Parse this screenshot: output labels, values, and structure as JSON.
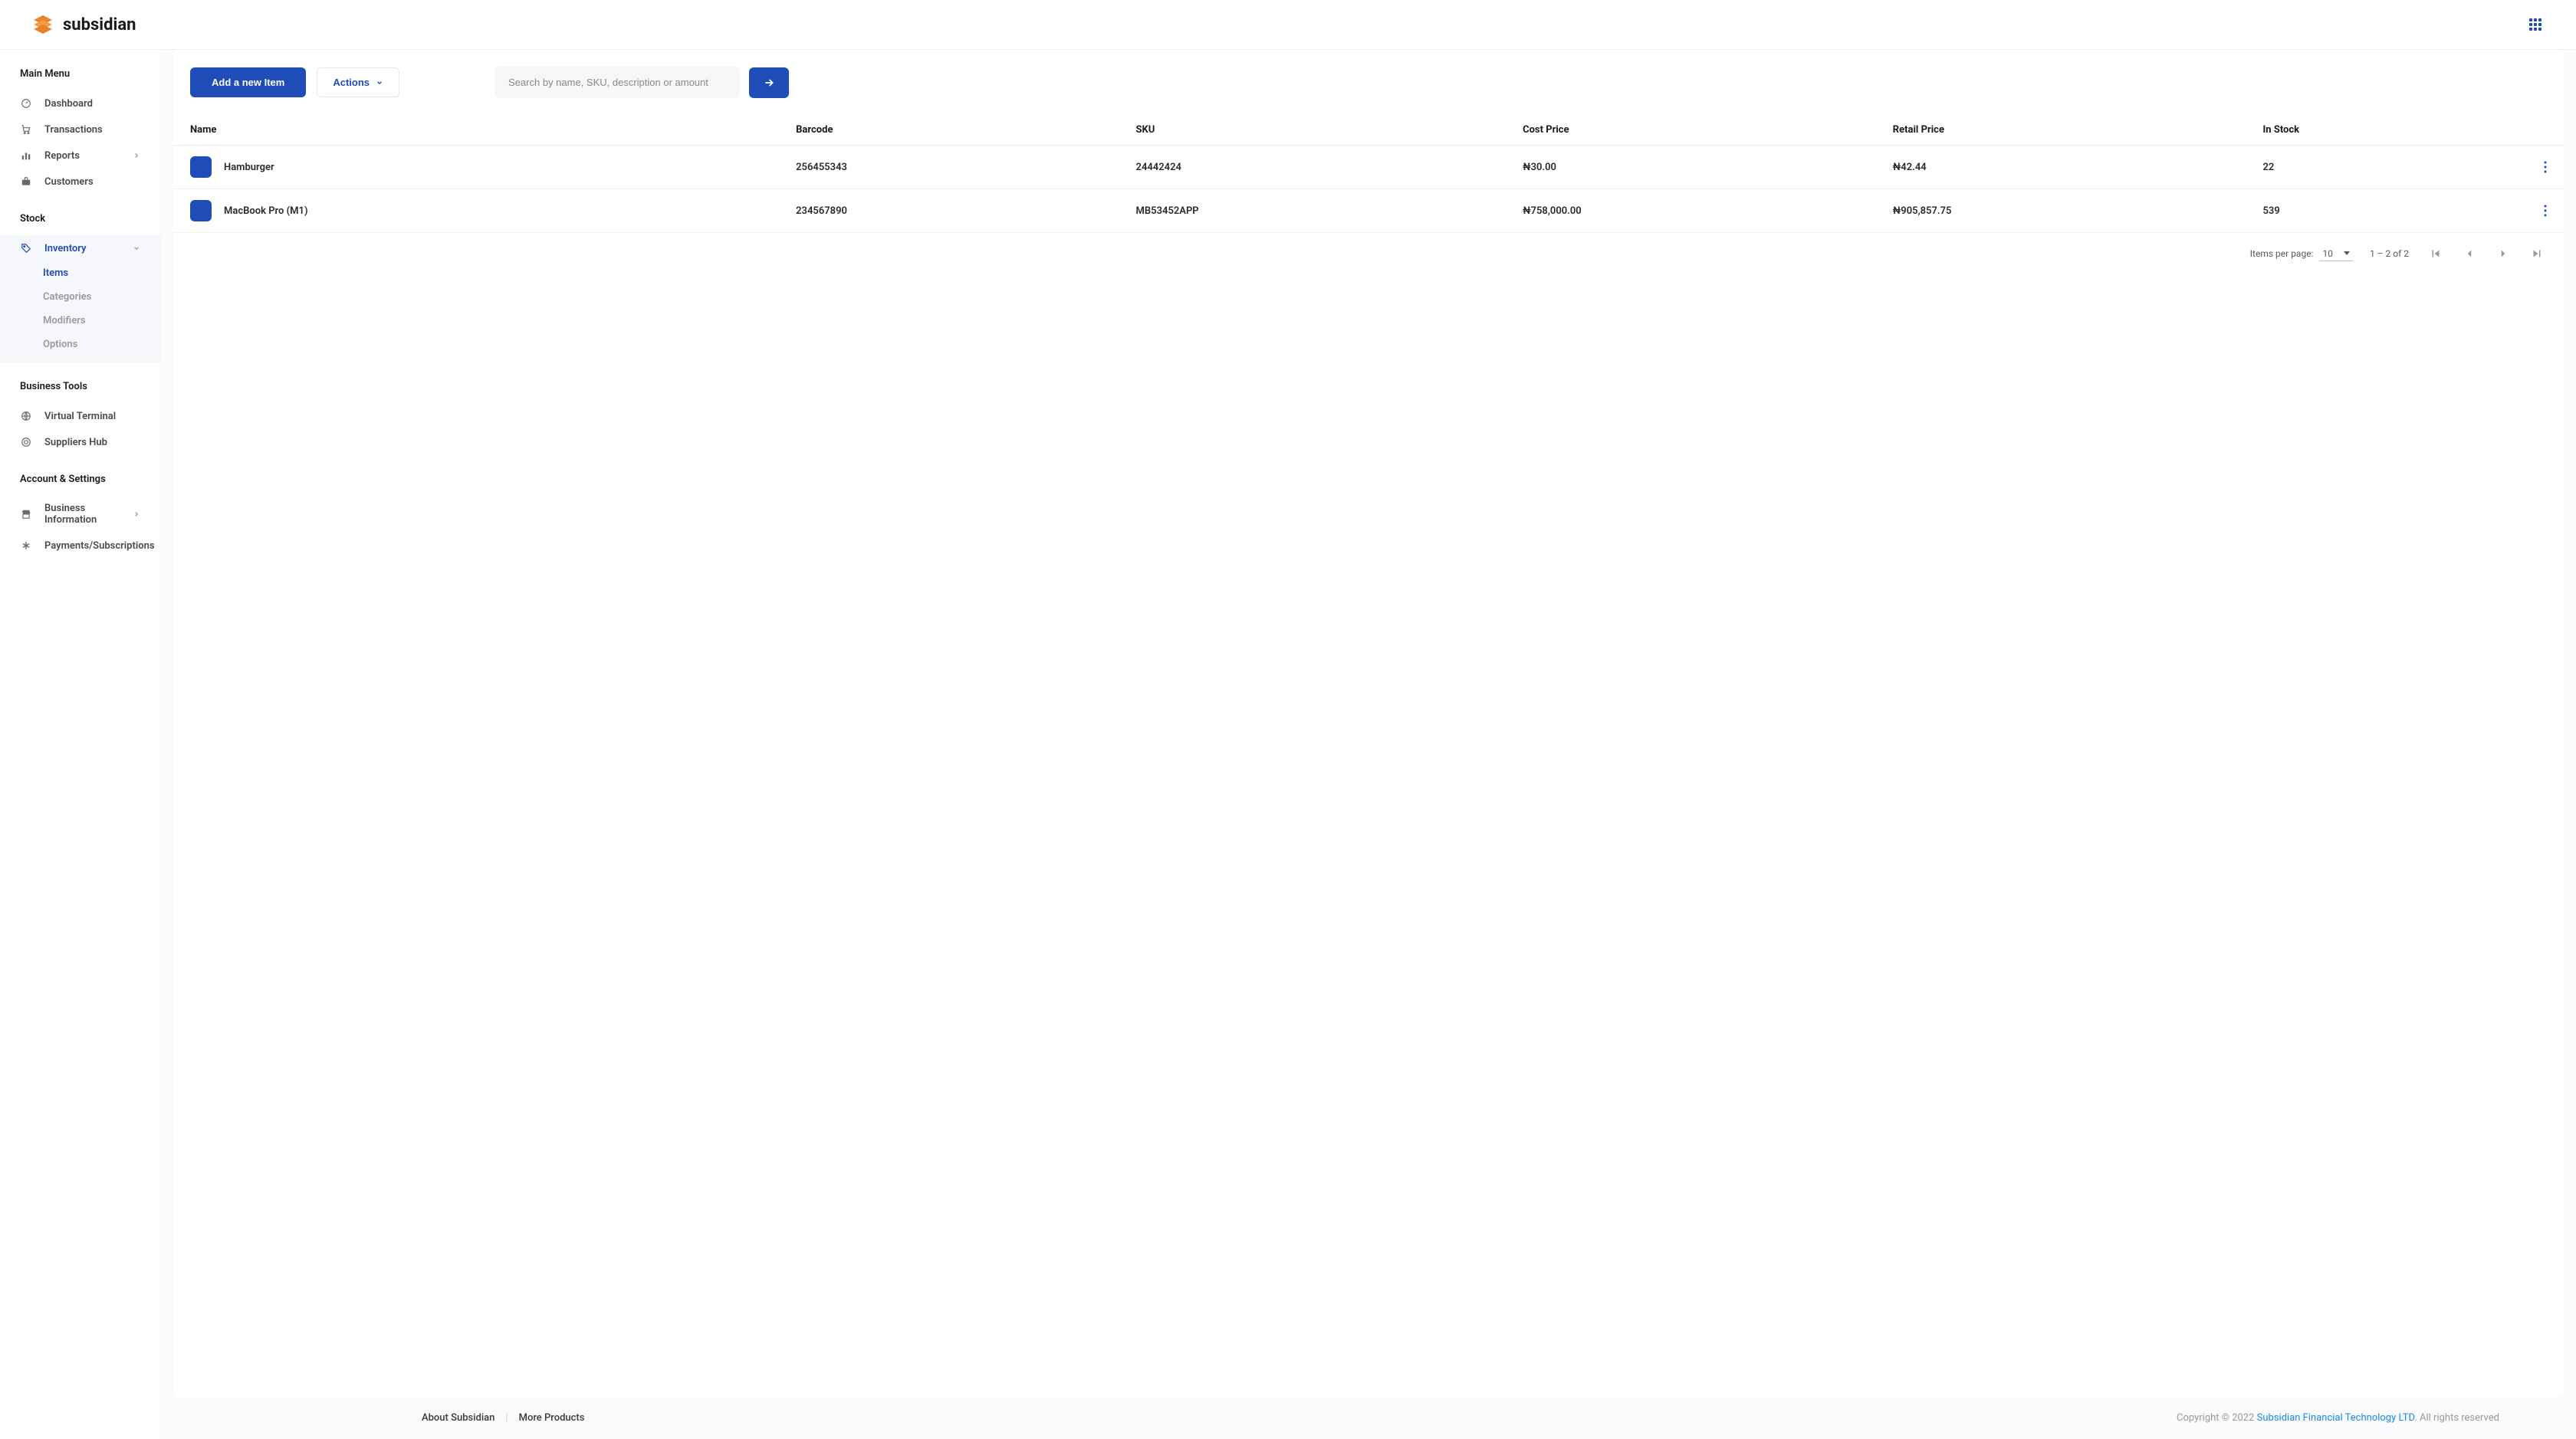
{
  "header": {
    "brand_name": "subsidian"
  },
  "sidebar": {
    "sections": [
      {
        "heading": "Main Menu",
        "items": [
          {
            "label": "Dashboard",
            "icon": "gauge"
          },
          {
            "label": "Transactions",
            "icon": "cart"
          },
          {
            "label": "Reports",
            "icon": "chart",
            "chevron": true
          },
          {
            "label": "Customers",
            "icon": "briefcase"
          }
        ]
      },
      {
        "heading": "Stock",
        "items": [
          {
            "label": "Inventory",
            "icon": "tag",
            "chevron_down": true,
            "active": true
          }
        ],
        "subitems": [
          {
            "label": "Items",
            "active": true
          },
          {
            "label": "Categories"
          },
          {
            "label": "Modifiers"
          },
          {
            "label": "Options"
          }
        ]
      },
      {
        "heading": "Business Tools",
        "items": [
          {
            "label": "Virtual Terminal",
            "icon": "globe"
          },
          {
            "label": "Suppliers Hub",
            "icon": "globe-alt"
          }
        ]
      },
      {
        "heading": "Account & Settings",
        "items": [
          {
            "label": "Business Information",
            "icon": "store",
            "chevron": true
          },
          {
            "label": "Payments/Subscriptions",
            "icon": "asterisk"
          }
        ]
      }
    ]
  },
  "toolbar": {
    "add_label": "Add a new Item",
    "actions_label": "Actions",
    "search_placeholder": "Search by name, SKU, description or amount"
  },
  "table": {
    "columns": [
      "Name",
      "Barcode",
      "SKU",
      "Cost Price",
      "Retail Price",
      "In Stock"
    ],
    "rows": [
      {
        "name": "Hamburger",
        "barcode": "256455343",
        "sku": "24442424",
        "cost": "₦30.00",
        "retail": "₦42.44",
        "stock": "22"
      },
      {
        "name": "MacBook Pro (M1)",
        "barcode": "234567890",
        "sku": "MB53452APP",
        "cost": "₦758,000.00",
        "retail": "₦905,857.75",
        "stock": "539"
      }
    ]
  },
  "pagination": {
    "per_page_label": "Items per page:",
    "per_page_value": "10",
    "range_text": "1 – 2 of 2"
  },
  "footer": {
    "about": "About Subsidian",
    "more_products": "More Products",
    "copyright_prefix": "Copyright © 2022 ",
    "company": "Subsidian Financial Technology LTD",
    "rights": ". All rights reserved"
  }
}
